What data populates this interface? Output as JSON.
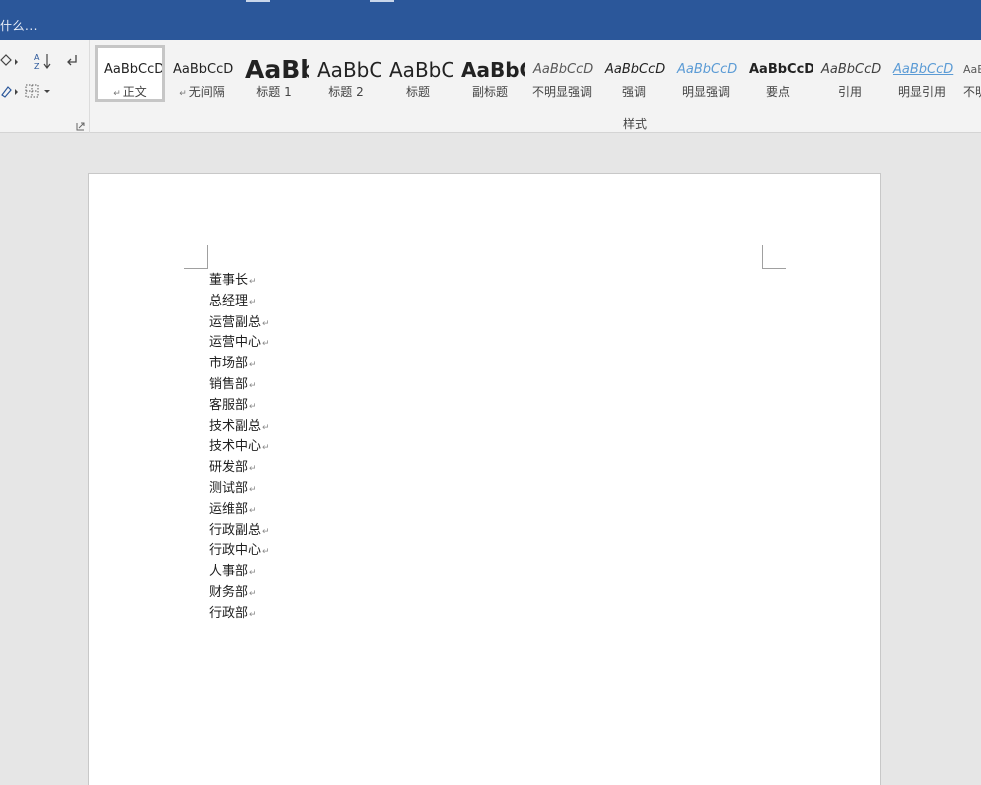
{
  "app": {
    "tell_me": "什么..."
  },
  "ribbon": {
    "group_label": "样式",
    "styles": [
      {
        "preview": "AaBbCcD",
        "label": "正文",
        "mark": "↵",
        "selected": true
      },
      {
        "preview": "AaBbCcD",
        "label": "无间隔",
        "mark": "↵"
      },
      {
        "preview": "AaBb",
        "label": "标题 1"
      },
      {
        "preview": "AaBbC",
        "label": "标题 2"
      },
      {
        "preview": "AaBbC",
        "label": "标题"
      },
      {
        "preview": "AaBbC",
        "label": "副标题"
      },
      {
        "preview": "AaBbCcD",
        "label": "不明显强调"
      },
      {
        "preview": "AaBbCcD",
        "label": "强调"
      },
      {
        "preview": "AaBbCcD",
        "label": "明显强调"
      },
      {
        "preview": "AaBbCcD",
        "label": "要点"
      },
      {
        "preview": "AaBbCcD",
        "label": "引用"
      },
      {
        "preview": "AaBbCcD",
        "label": "明显引用"
      },
      {
        "preview": "AaBbCcD",
        "label": "不明"
      }
    ]
  },
  "document": {
    "paragraph_mark": "↵",
    "lines": [
      "董事长",
      "总经理",
      "运营副总",
      "运营中心",
      "市场部",
      "销售部",
      "客服部",
      "技术副总",
      "技术中心",
      "研发部",
      "测试部",
      "运维部",
      "行政副总",
      "行政中心",
      "人事部",
      "财务部",
      "行政部"
    ]
  },
  "colors": {
    "title_bar": "#2b579a",
    "intense_emphasis": "#5b9bd5"
  }
}
